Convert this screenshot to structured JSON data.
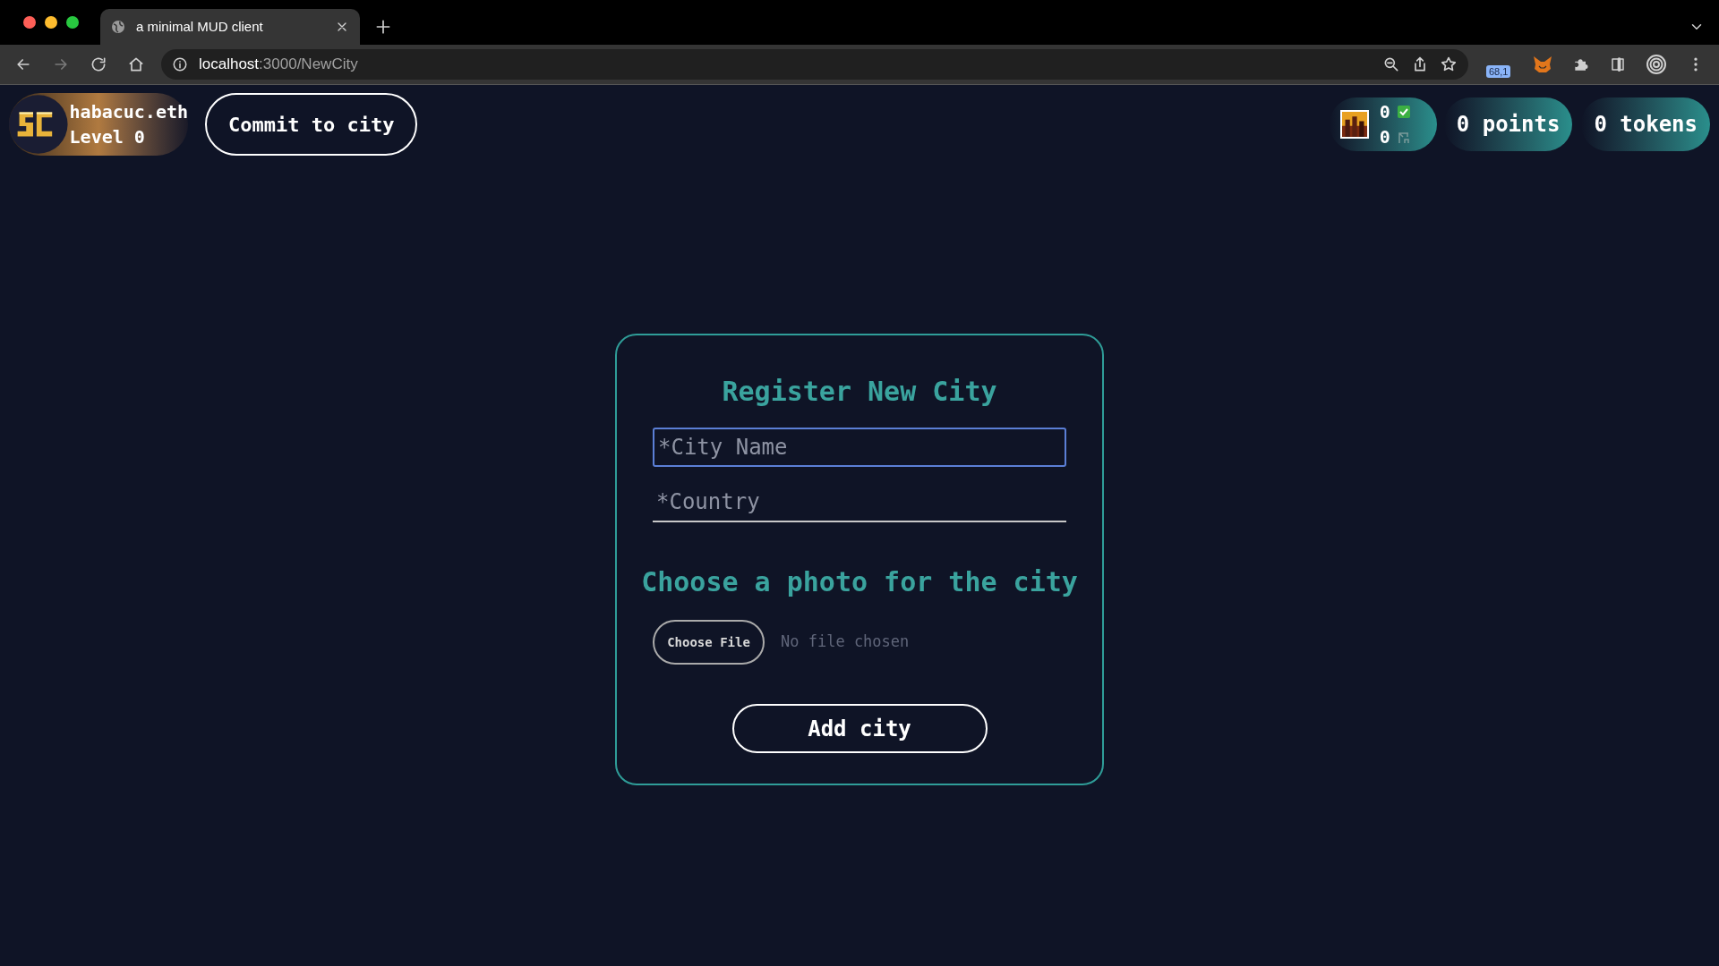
{
  "browser": {
    "tab": {
      "title": "a minimal MUD client",
      "selected": true
    },
    "url": {
      "host": "localhost",
      "path": ":3000/NewCity"
    },
    "extension_badge": "68,1"
  },
  "header": {
    "user": {
      "name": "habacuc.eth",
      "level": "Level 0"
    },
    "commit_button": "Commit to city",
    "stats": {
      "confirmed": "0",
      "pending": "0"
    },
    "points": "0 points",
    "tokens": "0 tokens"
  },
  "form": {
    "title": "Register New City",
    "fields": [
      {
        "placeholder": "*City Name",
        "focused": true
      },
      {
        "placeholder": "*Country",
        "focused": false
      }
    ],
    "photo_heading": "Choose a photo for the city",
    "file_button": "Choose File",
    "file_status": "No file chosen",
    "submit": "Add city"
  }
}
